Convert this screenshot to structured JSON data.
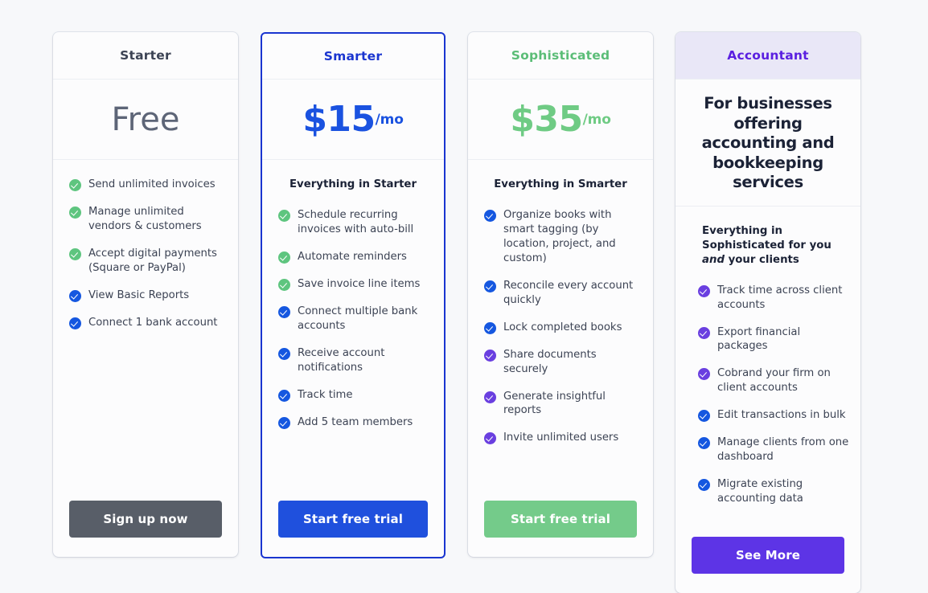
{
  "plans": [
    {
      "name": "Starter",
      "name_color": "#3c4354",
      "price": "Free",
      "price_suffix": "",
      "price_color": "#5d6577",
      "featured": false,
      "header_bg": "",
      "description": "",
      "everything": "",
      "features": [
        {
          "text": "Send unlimited invoices",
          "check": "green"
        },
        {
          "text": "Manage unlimited vendors & customers",
          "check": "green"
        },
        {
          "text": "Accept digital payments (Square or PayPal)",
          "check": "green"
        },
        {
          "text": "View Basic Reports",
          "check": "blue"
        },
        {
          "text": "Connect 1 bank account",
          "check": "blue"
        }
      ],
      "cta_label": "Sign up now",
      "cta_bg": "#585e68"
    },
    {
      "name": "Smarter",
      "name_color": "#1a35d0",
      "price": "$15",
      "price_suffix": "/mo",
      "price_color": "#1a52e0",
      "featured": true,
      "header_bg": "",
      "description": "",
      "everything": "Everything in Starter",
      "features": [
        {
          "text": "Schedule recurring invoices with auto-bill",
          "check": "green"
        },
        {
          "text": "Automate reminders",
          "check": "green"
        },
        {
          "text": "Save invoice line items",
          "check": "green"
        },
        {
          "text": "Connect multiple bank accounts",
          "check": "blue"
        },
        {
          "text": "Receive account notifications",
          "check": "blue"
        },
        {
          "text": "Track time",
          "check": "blue"
        },
        {
          "text": "Add 5 team members",
          "check": "blue"
        }
      ],
      "cta_label": "Start free trial",
      "cta_bg": "#1f50dd"
    },
    {
      "name": "Sophisticated",
      "name_color": "#5bbd77",
      "price": "$35",
      "price_suffix": "/mo",
      "price_color": "#6fcb84",
      "featured": false,
      "header_bg": "",
      "description": "",
      "everything": "Everything in Smarter",
      "features": [
        {
          "text": "Organize books with smart tagging (by location, project, and custom)",
          "check": "blue"
        },
        {
          "text": "Reconcile every account quickly",
          "check": "blue"
        },
        {
          "text": "Lock completed books",
          "check": "blue"
        },
        {
          "text": "Share documents securely",
          "check": "purple"
        },
        {
          "text": "Generate insightful reports",
          "check": "purple"
        },
        {
          "text": "Invite unlimited users",
          "check": "purple"
        }
      ],
      "cta_label": "Start free trial",
      "cta_bg": "#74cb8a"
    },
    {
      "name": "Accountant",
      "name_color": "#5a1fe0",
      "price": "",
      "price_suffix": "",
      "price_color": "",
      "featured": false,
      "header_bg": "#e9e7f7",
      "description": "For businesses offering accounting and bookkeeping services",
      "everything_pre": "Everything in Sophisticated for you ",
      "everything_em": "and",
      "everything_post": " your clients",
      "features": [
        {
          "text": "Track time across client accounts",
          "check": "purple"
        },
        {
          "text": "Export financial packages",
          "check": "purple"
        },
        {
          "text": "Cobrand your firm on client accounts",
          "check": "purple"
        },
        {
          "text": "Edit transactions in bulk",
          "check": "blue"
        },
        {
          "text": "Manage clients from one dashboard",
          "check": "blue"
        },
        {
          "text": "Migrate existing accounting data",
          "check": "blue"
        }
      ],
      "cta_label": "See More",
      "cta_bg": "#5d34e6"
    }
  ]
}
